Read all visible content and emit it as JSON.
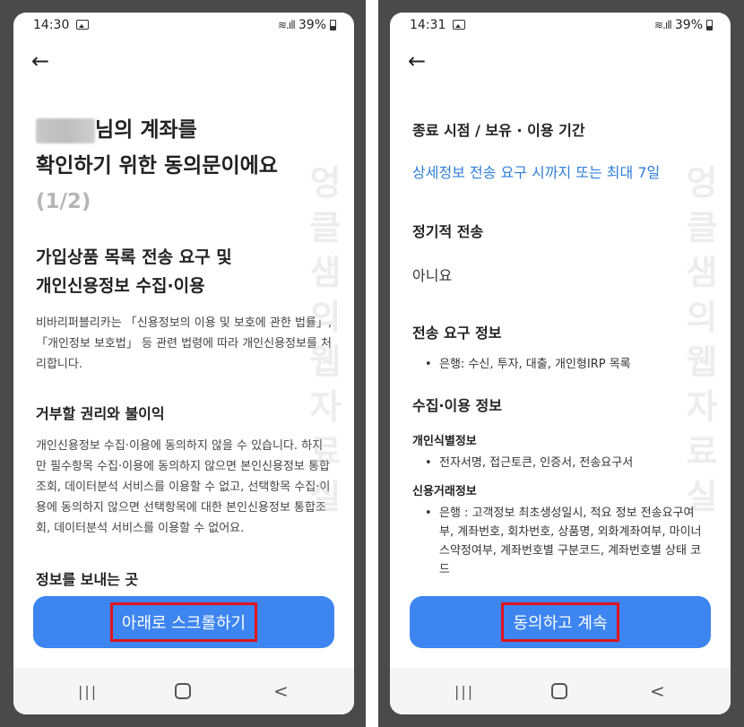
{
  "left": {
    "status": {
      "time": "14:30",
      "battery": "39%"
    },
    "title_line1_suffix": "님의 계좌를",
    "title_line2": "확인하기 위한 동의문이에요",
    "title_step": "(1/2)",
    "section1_title_line1": "가입상품 목록 전송 요구 및",
    "section1_title_line2": "개인신용정보 수집·이용",
    "section1_text": "비바리퍼블리카는 「신용정보의 이용 및 보호에 관한 법률」, 「개인정보 보호법」 등 관련 법령에 따라 개인신용정보를 처리합니다.",
    "section2_title": "거부할 권리와 불이익",
    "section2_text": "개인신용정보 수집·이용에 동의하지 않을 수 있습니다. 하지만 필수항목 수집·이용에 동의하지 않으면 본인신용정보 통합조회, 데이터분석 서비스를 이용할 수 없고, 선택항목 수집·이용에 동의하지 않으면 선택항목에 대한 본인신용정보 통합조회, 데이터분석 서비스를 이용할 수 없어요.",
    "section3_title": "정보를 보내는 곳",
    "cta_label": "아래로 스크롤하기"
  },
  "right": {
    "status": {
      "time": "14:31",
      "battery": "39%"
    },
    "period_title": "종료 시점 / 보유 · 이용 기간",
    "period_value": "상세정보 전송 요구 시까지 또는 최대 7일",
    "regular_title": "정기적 전송",
    "regular_value": "아니요",
    "request_title": "전송 요구 정보",
    "request_items": [
      "은행: 수신, 투자, 대출, 개인형IRP 목록"
    ],
    "collect_title": "수집·이용 정보",
    "id_title": "개인식별정보",
    "id_items": [
      "전자서명, 접근토큰, 인증서, 전송요구서"
    ],
    "credit_title": "신용거래정보",
    "credit_items": [
      "은행 : 고객정보 최초생성일시, 적요 정보 전송요구여부, 계좌번호, 회차번호, 상품명, 외화계좌여부, 마이너스약정여부, 계좌번호별 구분코드, 계좌번호별 상태 코드"
    ],
    "cta_label": "동의하고 계속"
  },
  "watermark": [
    "엉",
    "클",
    "샘",
    "의",
    "웹",
    "자",
    "료",
    "실"
  ],
  "nav": {
    "recent": "|||",
    "back": "<"
  }
}
